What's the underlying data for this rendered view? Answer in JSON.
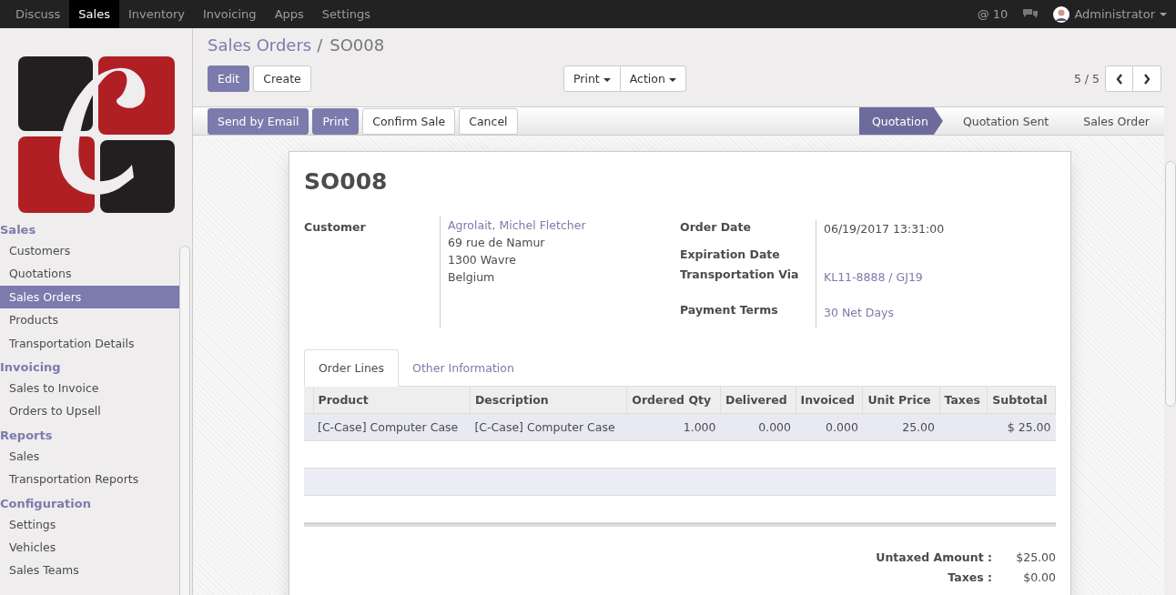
{
  "top_menu": [
    {
      "label": "Discuss",
      "selected": false
    },
    {
      "label": "Sales",
      "selected": true
    },
    {
      "label": "Inventory",
      "selected": false
    },
    {
      "label": "Invoicing",
      "selected": false
    },
    {
      "label": "Apps",
      "selected": false
    },
    {
      "label": "Settings",
      "selected": false
    }
  ],
  "systray": {
    "mentions": "@ 10",
    "user": "Administrator"
  },
  "sidebar": {
    "sections": [
      {
        "title": "Sales",
        "items": [
          {
            "label": "Customers",
            "selected": false
          },
          {
            "label": "Quotations",
            "selected": false
          },
          {
            "label": "Sales Orders",
            "selected": true
          },
          {
            "label": "Products",
            "selected": false
          },
          {
            "label": "Transportation Details",
            "selected": false
          }
        ]
      },
      {
        "title": "Invoicing",
        "items": [
          {
            "label": "Sales to Invoice",
            "selected": false
          },
          {
            "label": "Orders to Upsell",
            "selected": false
          }
        ]
      },
      {
        "title": "Reports",
        "items": [
          {
            "label": "Sales",
            "selected": false
          },
          {
            "label": "Transportation Reports",
            "selected": false
          }
        ]
      },
      {
        "title": "Configuration",
        "items": [
          {
            "label": "Settings",
            "selected": false
          },
          {
            "label": "Vehicles",
            "selected": false
          },
          {
            "label": "Sales Teams",
            "selected": false
          }
        ]
      }
    ]
  },
  "breadcrumb": {
    "parent": "Sales Orders",
    "separator": "/",
    "current": "SO008"
  },
  "buttons": [
    {
      "label": "Edit",
      "primary": true
    },
    {
      "label": "Create",
      "primary": false
    }
  ],
  "dropdowns": [
    "Print",
    "Action"
  ],
  "pager": "5 / 5",
  "status_buttons": [
    {
      "label": "Send by Email",
      "primary": true
    },
    {
      "label": "Print",
      "primary": true
    },
    {
      "label": "Confirm Sale",
      "primary": false
    },
    {
      "label": "Cancel",
      "primary": false
    }
  ],
  "stages": [
    {
      "label": "Quotation",
      "selected": true
    },
    {
      "label": "Quotation Sent",
      "selected": false
    },
    {
      "label": "Sales Order",
      "selected": false
    }
  ],
  "form": {
    "title": "SO008",
    "customer": {
      "label": "Customer",
      "name": "Agrolait, Michel Fletcher",
      "address": [
        "69 rue de Namur",
        "1300 Wavre",
        "Belgium"
      ]
    },
    "fields": [
      {
        "label": "Order Date",
        "value": "06/19/2017 13:31:00",
        "link": false
      },
      {
        "label": "Expiration Date"
      },
      {
        "label": "Transportation Via",
        "value": "KL11-8888 / GJ19",
        "link": true
      },
      {
        "label": "Payment Terms",
        "value": "30 Net Days",
        "link": true
      }
    ],
    "tabs": [
      {
        "label": "Order Lines",
        "selected": true
      },
      {
        "label": "Other Information",
        "selected": false
      }
    ],
    "columns": [
      "Product",
      "Description",
      "Ordered Qty",
      "Delivered",
      "Invoiced",
      "Unit Price",
      "Taxes",
      "Subtotal"
    ],
    "rows": [
      [
        "[C-Case] Computer Case",
        "[C-Case] Computer Case",
        "1.000",
        "0.000",
        "0.000",
        "25.00",
        "",
        "$ 25.00"
      ]
    ],
    "totals": [
      {
        "label": "Untaxed Amount :",
        "value": "$25.00"
      },
      {
        "label": "Taxes :",
        "value": "$0.00"
      }
    ]
  }
}
